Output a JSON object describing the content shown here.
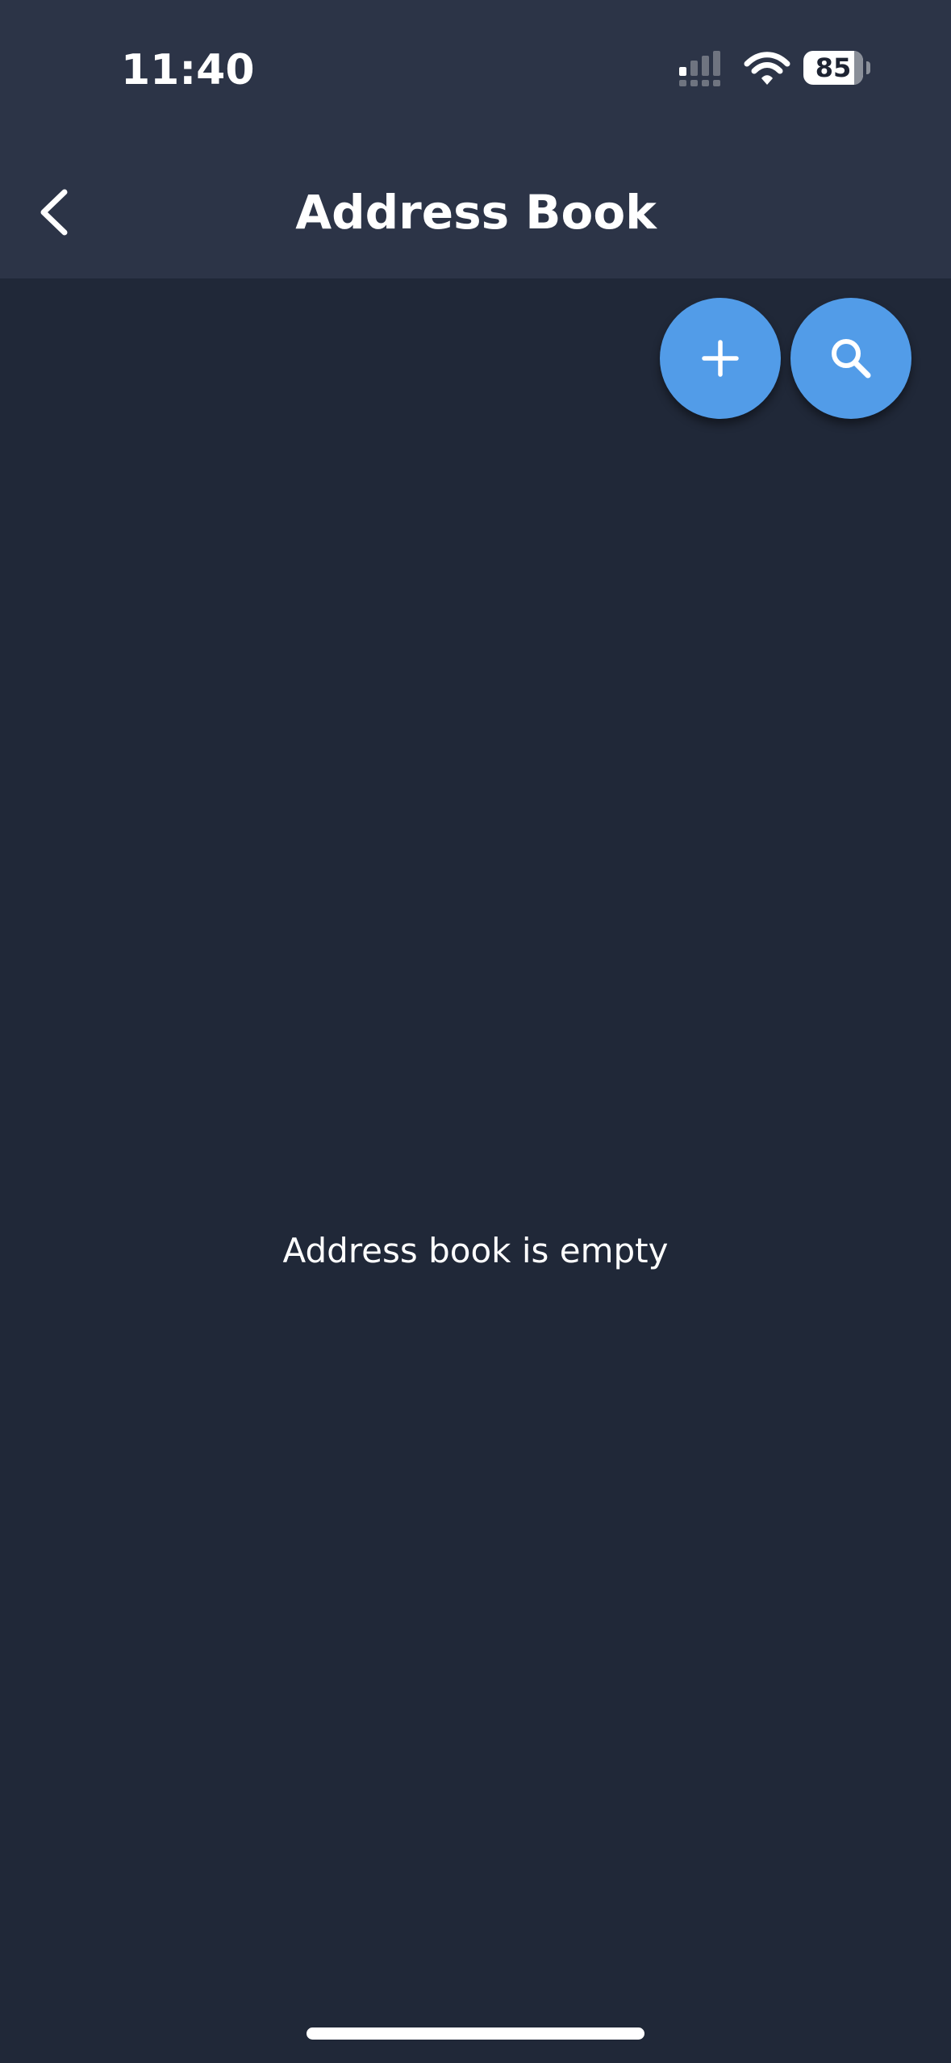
{
  "status_bar": {
    "time": "11:40",
    "battery": "85",
    "signal_icon": "cellular-signal-icon",
    "wifi_icon": "wifi-icon",
    "battery_icon": "battery-icon"
  },
  "header": {
    "title": "Address Book",
    "back_icon": "chevron-left-icon"
  },
  "actions": {
    "add_icon": "plus-icon",
    "search_icon": "search-icon"
  },
  "content": {
    "empty_message": "Address book is empty"
  },
  "colors": {
    "background": "#202838",
    "header_background": "#2c3447",
    "accent": "#529ce8",
    "text": "#ffffff"
  }
}
